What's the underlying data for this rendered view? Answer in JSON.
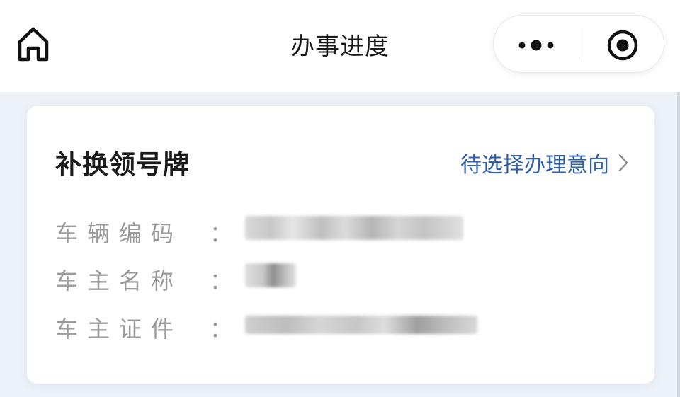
{
  "header": {
    "title": "办事进度",
    "home_icon": "home-icon",
    "more_icon": "more-dots-icon",
    "close_icon": "target-circle-icon"
  },
  "card": {
    "title": "补换领号牌",
    "status": "待选择办理意向",
    "chevron_icon": "chevron-right-icon",
    "rows": [
      {
        "label": "车辆编码",
        "colon": "："
      },
      {
        "label": "车主名称",
        "colon": "："
      },
      {
        "label": "车主证件",
        "colon": "："
      }
    ]
  },
  "colors": {
    "accent": "#2f5fa8",
    "background": "#edf2f8"
  }
}
